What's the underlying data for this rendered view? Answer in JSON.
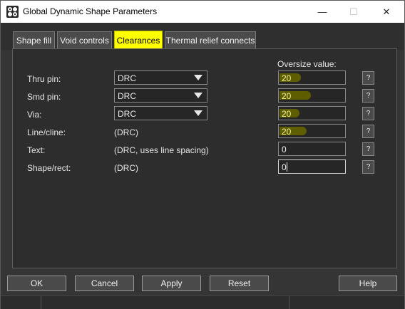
{
  "window": {
    "title": "Global Dynamic Shape Parameters"
  },
  "window_controls": {
    "minimize": "—",
    "maximize": "☐",
    "close": "✕"
  },
  "tabs": [
    {
      "label": "Shape fill",
      "active": false
    },
    {
      "label": "Void controls",
      "active": false
    },
    {
      "label": "Clearances",
      "active": true
    },
    {
      "label": "Thermal relief connects",
      "active": false
    }
  ],
  "clearances": {
    "oversize_header": "Oversize value:",
    "help_label": "?",
    "rows": [
      {
        "label": "Thru pin:",
        "value": "DRC",
        "oversize": "20"
      },
      {
        "label": "Smd pin:",
        "value": "DRC",
        "oversize": "20"
      },
      {
        "label": "Via:",
        "value": "DRC",
        "oversize": "20"
      },
      {
        "label": "Line/cline:",
        "value": "(DRC)",
        "oversize": "20"
      },
      {
        "label": "Text:",
        "value": "(DRC, uses line spacing)",
        "oversize": "0"
      },
      {
        "label": "Shape/rect:",
        "value": "(DRC)",
        "oversize": "0"
      }
    ]
  },
  "buttons": {
    "ok": "OK",
    "cancel": "Cancel",
    "apply": "Apply",
    "reset": "Reset",
    "help": "Help"
  },
  "colors": {
    "highlight": "#ffff00",
    "background": "#353535"
  }
}
